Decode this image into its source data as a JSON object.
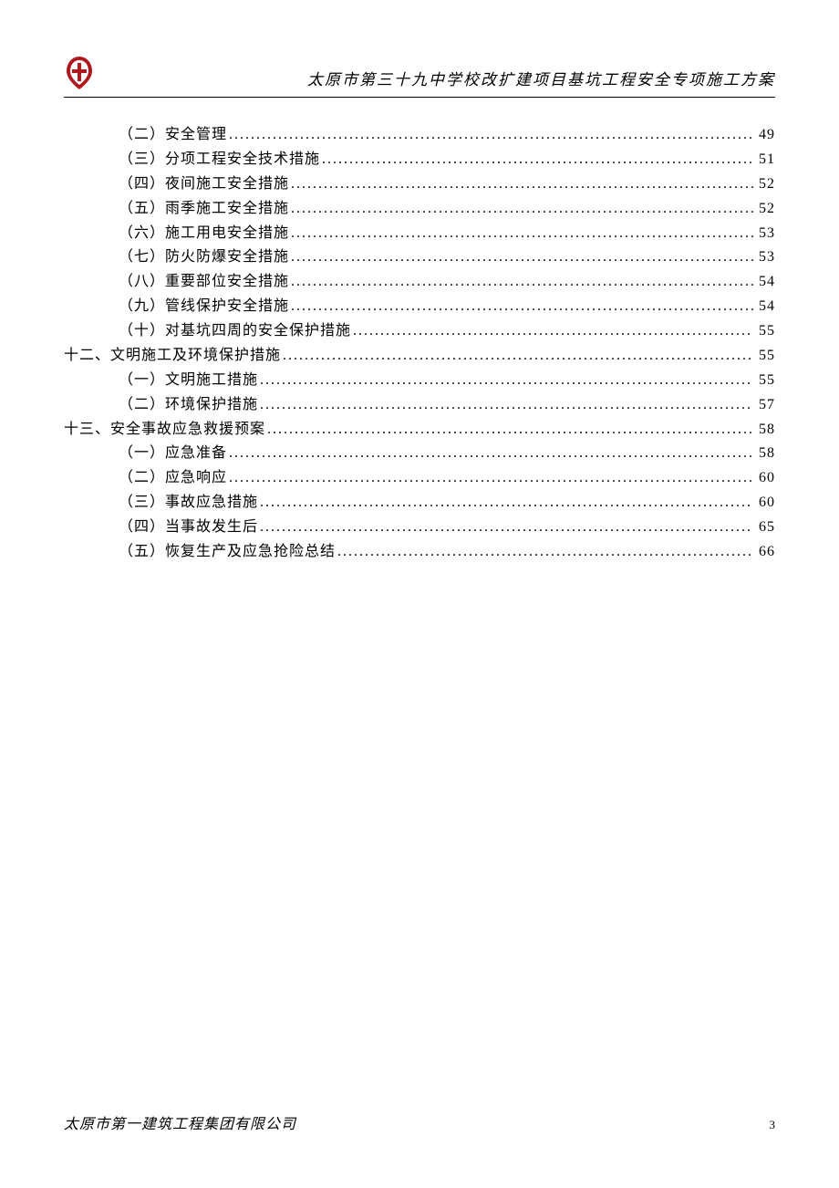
{
  "header": {
    "title": "太原市第三十九中学校改扩建项目基坑工程安全专项施工方案",
    "logo_color_outer": "#b1181e",
    "logo_color_inner": "#b1181e"
  },
  "toc": [
    {
      "level": 2,
      "label": "（二）安全管理",
      "page": "49"
    },
    {
      "level": 2,
      "label": "（三）分项工程安全技术措施",
      "page": "51"
    },
    {
      "level": 2,
      "label": "（四）夜间施工安全措施",
      "page": "52"
    },
    {
      "level": 2,
      "label": "（五）雨季施工安全措施",
      "page": "52"
    },
    {
      "level": 2,
      "label": "（六）施工用电安全措施",
      "page": "53"
    },
    {
      "level": 2,
      "label": "（七）防火防爆安全措施",
      "page": "53"
    },
    {
      "level": 2,
      "label": "（八）重要部位安全措施",
      "page": "54"
    },
    {
      "level": 2,
      "label": "（九）管线保护安全措施",
      "page": "54"
    },
    {
      "level": 2,
      "label": "（十）对基坑四周的安全保护措施",
      "page": "55"
    },
    {
      "level": 1,
      "label": "十二、文明施工及环境保护措施",
      "page": "55"
    },
    {
      "level": 2,
      "label": "（一）文明施工措施",
      "page": "55"
    },
    {
      "level": 2,
      "label": "（二）环境保护措施",
      "page": "57"
    },
    {
      "level": 1,
      "label": "十三、安全事故应急救援预案",
      "page": "58"
    },
    {
      "level": 2,
      "label": "（一）应急准备",
      "page": "58"
    },
    {
      "level": 2,
      "label": "（二）应急响应",
      "page": "60"
    },
    {
      "level": 2,
      "label": "（三）事故应急措施",
      "page": "60"
    },
    {
      "level": 2,
      "label": "（四）当事故发生后",
      "page": "65"
    },
    {
      "level": 2,
      "label": "（五）恢复生产及应急抢险总结",
      "page": "66"
    }
  ],
  "footer": {
    "company": "太原市第一建筑工程集团有限公司",
    "page_number": "3"
  }
}
